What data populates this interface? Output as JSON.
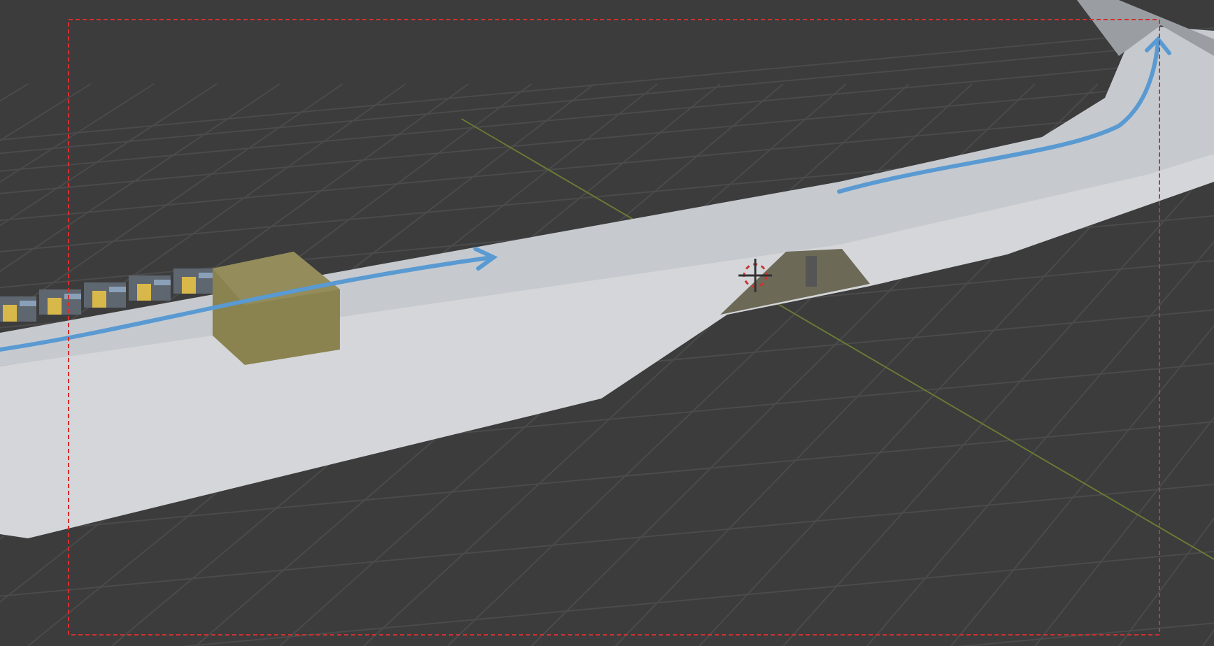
{
  "viewport": {
    "kind": "perspective",
    "camera_frame": true
  }
}
